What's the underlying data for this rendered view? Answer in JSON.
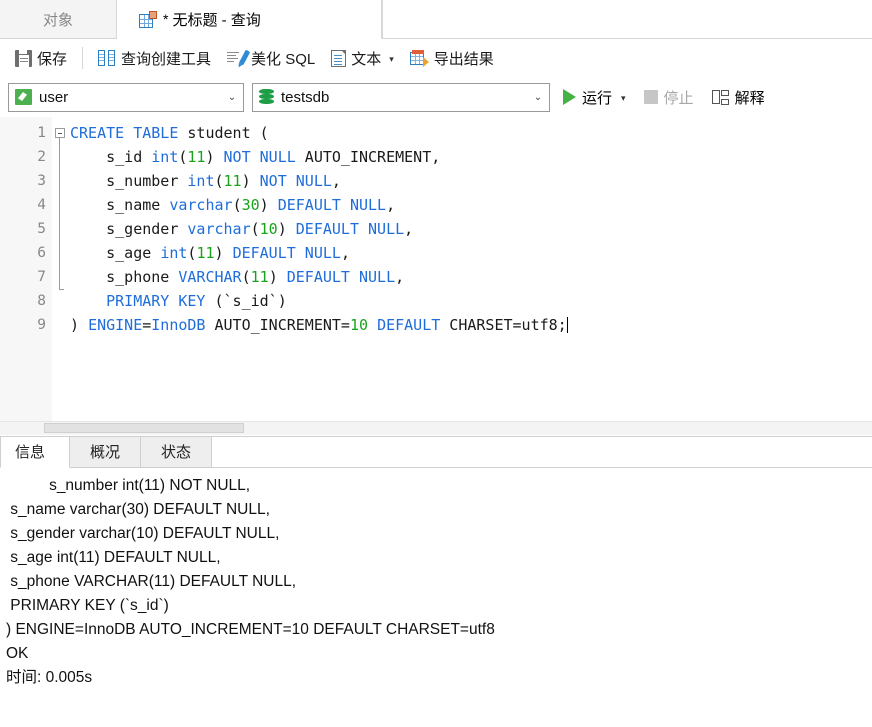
{
  "tabstrip": {
    "object_tab": "对象",
    "query_tab": {
      "star": "*",
      "label": "无标题 - 查询"
    }
  },
  "toolbar": {
    "save": "保存",
    "query_builder": "查询创建工具",
    "beautify_sql": "美化 SQL",
    "text": "文本",
    "text_caret": "▾",
    "export_result": "导出结果"
  },
  "connbar": {
    "connection": "user",
    "database": "testsdb",
    "combo_arrow": "⌄",
    "run": "运行",
    "run_caret": "▾",
    "stop": "停止",
    "explain": "解释"
  },
  "editor": {
    "line_numbers": [
      "1",
      "2",
      "3",
      "4",
      "5",
      "6",
      "7",
      "8",
      "9"
    ],
    "lines": [
      [
        {
          "t": "CREATE TABLE",
          "c": "kw"
        },
        {
          "t": " student (",
          "c": "pln"
        }
      ],
      [
        {
          "t": "    s_id ",
          "c": "pln"
        },
        {
          "t": "int",
          "c": "kw"
        },
        {
          "t": "(",
          "c": "pln"
        },
        {
          "t": "11",
          "c": "num"
        },
        {
          "t": ") ",
          "c": "pln"
        },
        {
          "t": "NOT NULL",
          "c": "kw"
        },
        {
          "t": " AUTO_INCREMENT,",
          "c": "pln"
        }
      ],
      [
        {
          "t": "    s_number ",
          "c": "pln"
        },
        {
          "t": "int",
          "c": "kw"
        },
        {
          "t": "(",
          "c": "pln"
        },
        {
          "t": "11",
          "c": "num"
        },
        {
          "t": ") ",
          "c": "pln"
        },
        {
          "t": "NOT NULL",
          "c": "kw"
        },
        {
          "t": ",",
          "c": "pln"
        }
      ],
      [
        {
          "t": "    s_name ",
          "c": "pln"
        },
        {
          "t": "varchar",
          "c": "kw"
        },
        {
          "t": "(",
          "c": "pln"
        },
        {
          "t": "30",
          "c": "num"
        },
        {
          "t": ") ",
          "c": "pln"
        },
        {
          "t": "DEFAULT NULL",
          "c": "kw"
        },
        {
          "t": ",",
          "c": "pln"
        }
      ],
      [
        {
          "t": "    s_gender ",
          "c": "pln"
        },
        {
          "t": "varchar",
          "c": "kw"
        },
        {
          "t": "(",
          "c": "pln"
        },
        {
          "t": "10",
          "c": "num"
        },
        {
          "t": ") ",
          "c": "pln"
        },
        {
          "t": "DEFAULT NULL",
          "c": "kw"
        },
        {
          "t": ",",
          "c": "pln"
        }
      ],
      [
        {
          "t": "    s_age ",
          "c": "pln"
        },
        {
          "t": "int",
          "c": "kw"
        },
        {
          "t": "(",
          "c": "pln"
        },
        {
          "t": "11",
          "c": "num"
        },
        {
          "t": ") ",
          "c": "pln"
        },
        {
          "t": "DEFAULT NULL",
          "c": "kw"
        },
        {
          "t": ",",
          "c": "pln"
        }
      ],
      [
        {
          "t": "    s_phone ",
          "c": "pln"
        },
        {
          "t": "VARCHAR",
          "c": "kw"
        },
        {
          "t": "(",
          "c": "pln"
        },
        {
          "t": "11",
          "c": "num"
        },
        {
          "t": ") ",
          "c": "pln"
        },
        {
          "t": "DEFAULT NULL",
          "c": "kw"
        },
        {
          "t": ",",
          "c": "pln"
        }
      ],
      [
        {
          "t": "    ",
          "c": "pln"
        },
        {
          "t": "PRIMARY KEY",
          "c": "kw"
        },
        {
          "t": " (`s_id`)",
          "c": "pln"
        }
      ],
      [
        {
          "t": ") ",
          "c": "pln"
        },
        {
          "t": "ENGINE",
          "c": "kw"
        },
        {
          "t": "=",
          "c": "pln"
        },
        {
          "t": "InnoDB",
          "c": "kw"
        },
        {
          "t": " AUTO_INCREMENT=",
          "c": "pln"
        },
        {
          "t": "10",
          "c": "num"
        },
        {
          "t": " ",
          "c": "pln"
        },
        {
          "t": "DEFAULT",
          "c": "kw"
        },
        {
          "t": " CHARSET=utf8;",
          "c": "pln"
        }
      ]
    ]
  },
  "bottom": {
    "tabs": [
      {
        "label": "信息",
        "active": true
      },
      {
        "label": "概况",
        "active": false
      },
      {
        "label": "状态",
        "active": false
      }
    ],
    "log": "          s_number int(11) NOT NULL,\n s_name varchar(30) DEFAULT NULL,\n s_gender varchar(10) DEFAULT NULL,\n s_age int(11) DEFAULT NULL,\n s_phone VARCHAR(11) DEFAULT NULL,\n PRIMARY KEY (`s_id`)\n) ENGINE=InnoDB AUTO_INCREMENT=10 DEFAULT CHARSET=utf8\nOK\n时间: 0.005s"
  }
}
